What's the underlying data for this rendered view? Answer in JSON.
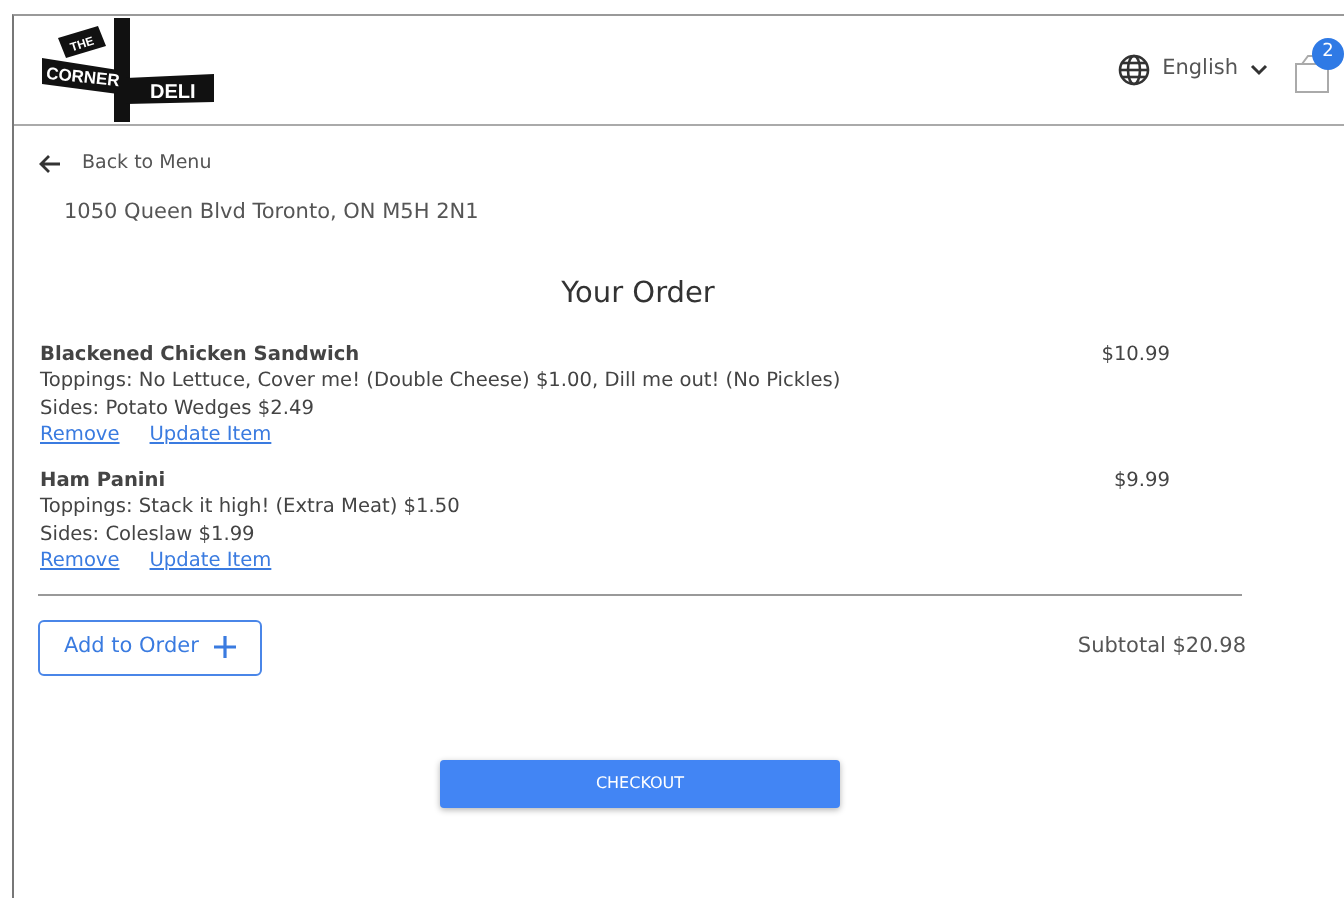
{
  "logo": {
    "top": "THE",
    "left": "CORNER",
    "right": "DELI"
  },
  "header": {
    "language": "English",
    "cart_count": "2"
  },
  "back_link": "Back to Menu",
  "address": "1050 Queen Blvd Toronto, ON M5H 2N1",
  "title": "Your Order",
  "items": [
    {
      "name": "Blackened Chicken Sandwich",
      "price": "$10.99",
      "details": [
        "Toppings: No Lettuce, Cover me! (Double Cheese) $1.00, Dill me out! (No Pickles)",
        "Sides: Potato Wedges $2.49"
      ],
      "links": [
        "Remove",
        "Update Item"
      ]
    },
    {
      "name": "Ham Panini",
      "price": "$9.99",
      "details": [
        "Toppings: Stack it high! (Extra Meat) $1.50",
        "Sides: Coleslaw $1.99"
      ],
      "links": [
        "Remove",
        "Update Item"
      ]
    }
  ],
  "add_button": "Add to Order",
  "subtotal": "Subtotal $20.98",
  "checkout": "CHECKOUT"
}
